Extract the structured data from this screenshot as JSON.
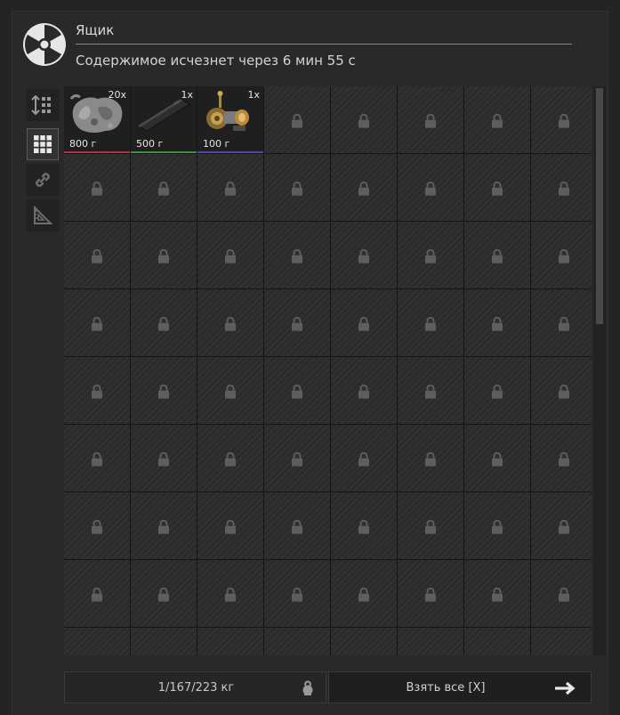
{
  "header": {
    "title": "Ящик",
    "subtitle": "Содержимое исчезнет через 6 мин 55 с"
  },
  "toolbar": {
    "icons": [
      "sort-icon",
      "grid-view-icon",
      "link-icon",
      "ruler-triangle-icon"
    ]
  },
  "items": [
    {
      "qty": "20x",
      "weight": "800 г",
      "bar_color": "#b03040",
      "icon": "ore-chunk-icon"
    },
    {
      "qty": "1x",
      "weight": "500 г",
      "bar_color": "#3f8f45",
      "icon": "metal-bar-icon"
    },
    {
      "qty": "1x",
      "weight": "100 г",
      "bar_color": "#5a44a8",
      "icon": "coil-device-icon"
    }
  ],
  "grid": {
    "columns": 8,
    "visible_rows": 9,
    "locked_icon": "lock-icon"
  },
  "footer": {
    "weight_text": "1/167/223 кг",
    "weight_icon": "kettlebell-icon",
    "take_all_label": "Взять все [X]",
    "take_all_icon": "arrow-right-icon"
  },
  "colors": {
    "background": "#242424",
    "cell": "#2b2b2b",
    "accent_line": "#8a8a8a"
  }
}
